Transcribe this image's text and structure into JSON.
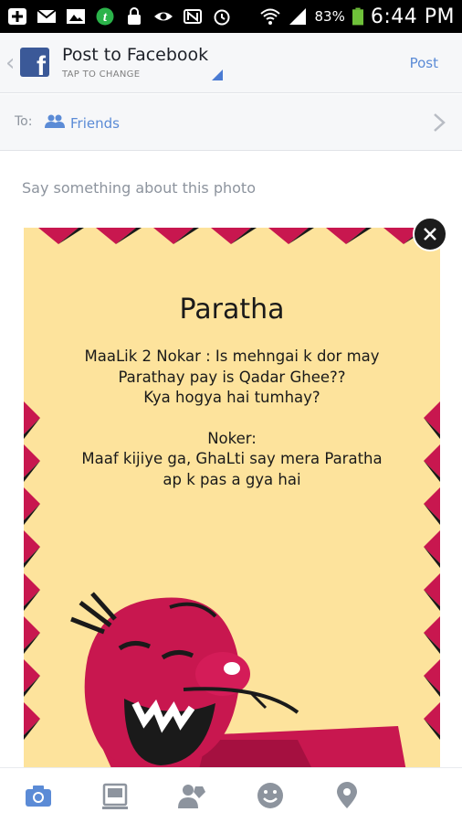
{
  "status_bar": {
    "battery_percent": "83%",
    "time": "6:44 PM"
  },
  "header": {
    "title": "Post to Facebook",
    "subtitle": "TAP TO CHANGE",
    "post_label": "Post"
  },
  "audience": {
    "to_label": "To:",
    "value": "Friends"
  },
  "composer": {
    "placeholder": "Say something about this photo"
  },
  "photo": {
    "title": "Paratha",
    "lines_block1": [
      "MaaLik 2 Nokar : Is mehngai k dor may",
      "Parathay pay is Qadar Ghee??",
      "Kya hogya hai tumhay?"
    ],
    "lines_block2": [
      "Noker:",
      "Maaf kijiye ga, GhaLti say mera Paratha",
      "ap k pas a gya hai"
    ]
  },
  "colors": {
    "facebook_blue": "#3b5998",
    "link_blue": "#5b8bd6",
    "photo_background": "#fde39c",
    "photo_accent": "#c8174f"
  },
  "toolbar": {
    "icons": [
      "camera-icon",
      "album-icon",
      "tag-people-icon",
      "emoji-icon",
      "location-pin-icon"
    ]
  }
}
